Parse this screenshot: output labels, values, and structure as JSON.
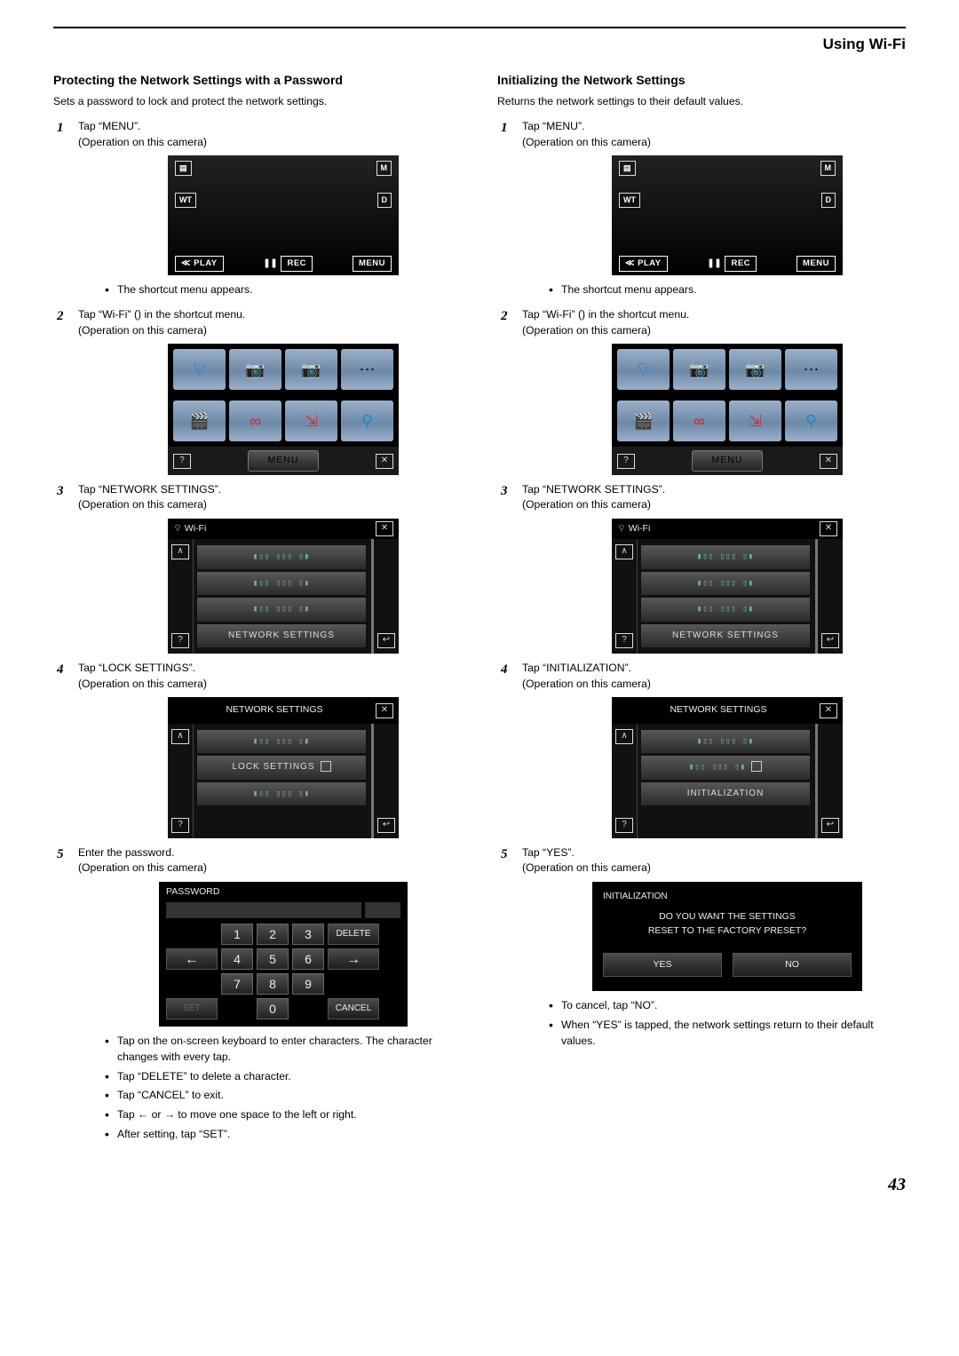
{
  "chapter": "Using Wi-Fi",
  "pagenum": "43",
  "icons": {
    "x": "✕",
    "back": "↩",
    "up": "∧",
    "help": "?",
    "pause": "❚❚",
    "left": "←",
    "right": "→",
    "wifi": "⌔"
  },
  "left": {
    "heading": "Protecting the Network Settings with a Password",
    "sub": "Sets a password to lock and protect the network settings.",
    "steps": {
      "1": {
        "text": "Tap “MENU”.",
        "note": "(Operation on this camera)",
        "bullet": "The shortcut menu appears."
      },
      "2": {
        "text": "Tap “Wi-Fi” () in the shortcut menu.",
        "note": "(Operation on this camera)"
      },
      "3": {
        "text": "Tap “NETWORK SETTINGS”.",
        "note": "(Operation on this camera)"
      },
      "4": {
        "text": "Tap “LOCK SETTINGS”.",
        "note": "(Operation on this camera)"
      },
      "5": {
        "text": "Enter the password.",
        "note": "(Operation on this camera)",
        "bullets": [
          "Tap on the on-screen keyboard to enter characters. The character changes with every tap.",
          "Tap “DELETE” to delete a character.",
          "Tap “CANCEL” to exit.",
          "Tap ← or → to move one space to the left or right.",
          "After setting, tap “SET”."
        ]
      }
    },
    "rec": {
      "play": "PLAY",
      "rec": "REC",
      "menu": "MENU",
      "M": "M",
      "D": "D",
      "WT": "WT"
    },
    "smenu": {
      "menu": "MENU"
    },
    "wifi_screen": {
      "title": "Wi-Fi",
      "item": "NETWORK SETTINGS"
    },
    "ns_screen": {
      "title": "NETWORK SETTINGS",
      "item": "LOCK SETTINGS"
    },
    "pwd": {
      "title": "PASSWORD",
      "delete": "DELETE",
      "cancel": "CANCEL",
      "set": "SET",
      "keys": [
        "1",
        "2",
        "3",
        "4",
        "5",
        "6",
        "7",
        "8",
        "9",
        "0"
      ]
    }
  },
  "right": {
    "heading": "Initializing the Network Settings",
    "sub": "Returns the network settings to their default values.",
    "steps": {
      "1": {
        "text": "Tap “MENU”.",
        "note": "(Operation on this camera)",
        "bullet": "The shortcut menu appears."
      },
      "2": {
        "text": "Tap “Wi-Fi” () in the shortcut menu.",
        "note": "(Operation on this camera)"
      },
      "3": {
        "text": "Tap “NETWORK SETTINGS”.",
        "note": "(Operation on this camera)"
      },
      "4": {
        "text": "Tap “INITIALIZATION”.",
        "note": "(Operation on this camera)"
      },
      "5": {
        "text": "Tap “YES”.",
        "note": "(Operation on this camera)",
        "bullets": [
          "To cancel, tap “NO”.",
          "When “YES” is tapped, the network settings return to their default values."
        ]
      }
    },
    "rec": {
      "play": "PLAY",
      "rec": "REC",
      "menu": "MENU",
      "M": "M",
      "D": "D",
      "WT": "WT"
    },
    "smenu": {
      "menu": "MENU"
    },
    "wifi_screen": {
      "title": "Wi-Fi",
      "item": "NETWORK SETTINGS"
    },
    "ns_screen": {
      "title": "NETWORK SETTINGS",
      "item": "INITIALIZATION"
    },
    "initd": {
      "title": "INITIALIZATION",
      "q1": "DO YOU WANT THE SETTINGS",
      "q2": "RESET TO THE FACTORY PRESET?",
      "yes": "YES",
      "no": "NO"
    }
  }
}
